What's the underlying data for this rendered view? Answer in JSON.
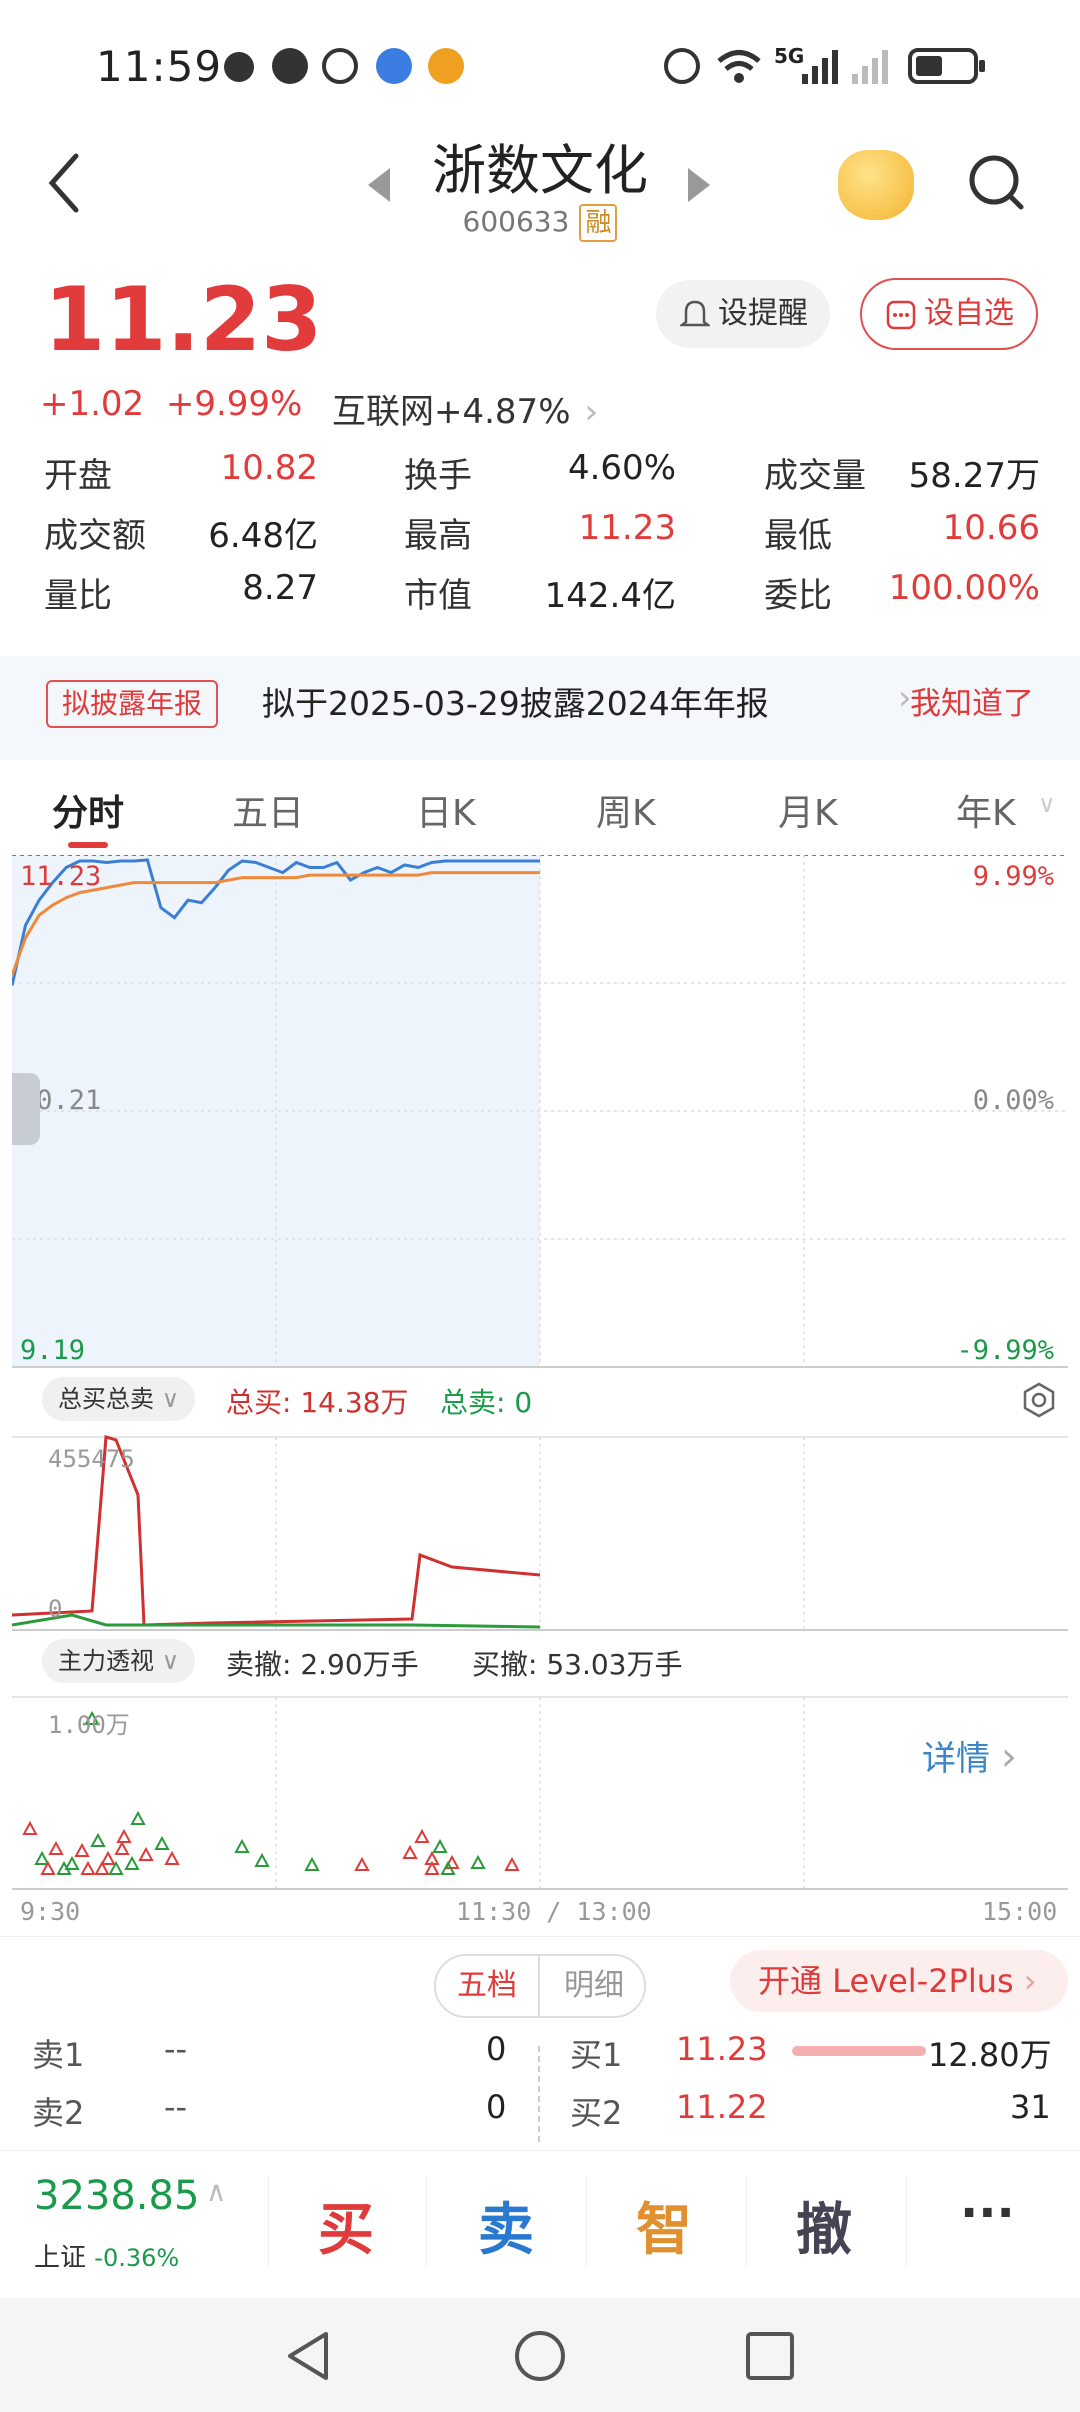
{
  "status_bar": {
    "time": "11:59",
    "network": "5G"
  },
  "header": {
    "stock_name": "浙数文化",
    "stock_code": "600633",
    "margin_tag": "融"
  },
  "quote": {
    "price": "11.23",
    "change": "+1.02",
    "change_pct": "+9.99%",
    "sector": "互联网+4.87%",
    "alert_label": "设提醒",
    "fav_label": "设自选",
    "stats": [
      [
        {
          "label": "开盘",
          "value": "10.82",
          "color": "#e23b3b"
        },
        {
          "label": "换手",
          "value": "4.60%",
          "color": "#222222"
        },
        {
          "label": "成交量",
          "value": "58.27万",
          "color": "#222222"
        }
      ],
      [
        {
          "label": "成交额",
          "value": "6.48亿",
          "color": "#222222"
        },
        {
          "label": "最高",
          "value": "11.23",
          "color": "#e23b3b"
        },
        {
          "label": "最低",
          "value": "10.66",
          "color": "#e23b3b"
        }
      ],
      [
        {
          "label": "量比",
          "value": "8.27",
          "color": "#222222"
        },
        {
          "label": "市值",
          "value": "142.4亿",
          "color": "#222222"
        },
        {
          "label": "委比",
          "value": "100.00%",
          "color": "#e23b3b"
        }
      ]
    ]
  },
  "notice": {
    "tag": "拟披露年报",
    "text": "拟于2025-03-29披露2024年年报",
    "action": "我知道了"
  },
  "tabs": [
    "分时",
    "五日",
    "日K",
    "周K",
    "月K",
    "年K"
  ],
  "chart": {
    "price_top": "11.23",
    "price_mid": "10.21",
    "price_bottom": "9.19",
    "pct_top": "9.99%",
    "pct_mid": "0.00%",
    "pct_bottom": "-9.99%",
    "sub1_selector": "总买总卖",
    "total_buy": "总买: 14.38万",
    "total_sell": "总卖: 0",
    "sub1_top": "455475",
    "sub1_zero": "0",
    "sub2_selector": "主力透视",
    "cancel_sell": "卖撤: 2.90万手",
    "cancel_buy": "买撤: 53.03万手",
    "sub2_top": "1.00万",
    "details": "详情",
    "time_start": "9:30",
    "time_mid": "11:30 / 13:00",
    "time_end": "15:00"
  },
  "chart_data": {
    "type": "line",
    "ylim": [
      9.19,
      11.23
    ],
    "series": [
      {
        "values": [
          10.71,
          10.95,
          11.05,
          11.12,
          11.18,
          11.23,
          11.23,
          11.2,
          11.23,
          11.23,
          11.21,
          11.02,
          10.98,
          11.05,
          11.04,
          11.1,
          11.17,
          11.23,
          11.2,
          11.18,
          11.16,
          11.2,
          11.18,
          11.18,
          11.2,
          11.13,
          11.16,
          11.18,
          11.16,
          11.19,
          11.18,
          11.2,
          11.23,
          11.23,
          11.23,
          11.23,
          11.23,
          11.23,
          11.23,
          11.23
        ]
      },
      {
        "values": [
          10.75,
          10.9,
          10.99,
          11.03,
          11.06,
          11.08,
          11.09,
          11.1,
          11.11,
          11.12,
          11.12,
          11.12,
          11.12,
          11.12,
          11.12,
          11.12,
          11.13,
          11.14,
          11.14,
          11.14,
          11.14,
          11.14,
          11.15,
          11.15,
          11.15,
          11.15,
          11.15,
          11.15,
          11.15,
          11.15,
          11.15,
          11.16,
          11.16,
          11.16,
          11.16,
          11.16,
          11.16,
          11.16,
          11.16,
          11.16
        ]
      }
    ]
  },
  "order_book": {
    "tab1": "五档",
    "tab2": "明细",
    "level2": "开通 Level-2Plus",
    "sell": [
      {
        "label": "卖1",
        "price": "--",
        "vol": "0"
      },
      {
        "label": "卖2",
        "price": "--",
        "vol": "0"
      }
    ],
    "buy": [
      {
        "label": "买1",
        "price": "11.23",
        "vol": "12.80万"
      },
      {
        "label": "买2",
        "price": "11.22",
        "vol": "31"
      }
    ]
  },
  "bottom_bar": {
    "index_value": "3238.85",
    "index_name": "上证",
    "index_change": "-0.36%",
    "buy": "买",
    "sell": "卖",
    "smart": "智",
    "cancel": "撤",
    "more": "···"
  }
}
